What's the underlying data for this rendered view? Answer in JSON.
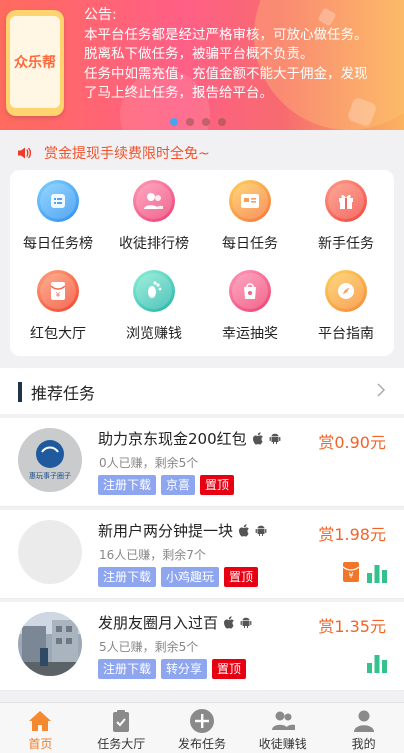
{
  "banner": {
    "logo_text": "众乐帮",
    "notice_title": "公告:",
    "notice_lines": [
      "本平台任务都是经过严格审核，可放心做任务。",
      "脱离私下做任务，被骗平台概不负责。",
      "任务中如需充值，充值金额不能大于佣金，发现",
      "了马上终止任务，报告给平台。"
    ],
    "slide_count": 4,
    "active_slide": 0
  },
  "marquee": {
    "text": "赏金提现手续费限时全免~"
  },
  "menu": {
    "items": [
      {
        "label": "每日任务榜",
        "icon": "list-icon",
        "color": "#3aa8f5"
      },
      {
        "label": "收徒排行榜",
        "icon": "users-icon",
        "color": "#f55a8c"
      },
      {
        "label": "每日任务",
        "icon": "card-icon",
        "color": "#fb9a3c"
      },
      {
        "label": "新手任务",
        "icon": "gift-icon",
        "color": "#f7584e"
      },
      {
        "label": "红包大厅",
        "icon": "red-packet-icon",
        "color": "#f5643c"
      },
      {
        "label": "浏览赚钱",
        "icon": "footprint-icon",
        "color": "#3fc3b5"
      },
      {
        "label": "幸运抽奖",
        "icon": "bag-icon",
        "color": "#f7608a"
      },
      {
        "label": "平台指南",
        "icon": "compass-icon",
        "color": "#fb9f3c"
      }
    ]
  },
  "recommend": {
    "title": "推荐任务",
    "tasks": [
      {
        "title": "助力京东现金200红包",
        "meta": "0人已赚，剩余5个",
        "price": "赏0.90元",
        "tags": [
          {
            "text": "注册下载",
            "color": "blue"
          },
          {
            "text": "京喜",
            "color": "blue"
          },
          {
            "text": "置顶",
            "color": "red"
          }
        ],
        "avatar_text": "惠玩事子圈子"
      },
      {
        "title": "新用户两分钟提一块",
        "meta": "16人已赚，剩余7个",
        "price": "赏1.98元",
        "tags": [
          {
            "text": "注册下载",
            "color": "blue"
          },
          {
            "text": "小鸡趣玩",
            "color": "blue"
          },
          {
            "text": "置顶",
            "color": "red"
          }
        ]
      },
      {
        "title": "发朋友圈月入过百",
        "meta": "5人已赚，剩余5个",
        "price": "赏1.35元",
        "tags": [
          {
            "text": "注册下载",
            "color": "blue"
          },
          {
            "text": "转分享",
            "color": "blue"
          },
          {
            "text": "置顶",
            "color": "red"
          }
        ]
      }
    ]
  },
  "tabbar": {
    "tabs": [
      {
        "label": "首页",
        "icon": "home-icon",
        "active": true
      },
      {
        "label": "任务大厅",
        "icon": "clipboard-icon",
        "active": false
      },
      {
        "label": "发布任务",
        "icon": "plus-circle-icon",
        "active": false
      },
      {
        "label": "收徒赚钱",
        "icon": "users-icon",
        "active": false
      },
      {
        "label": "我的",
        "icon": "person-icon",
        "active": false
      }
    ]
  },
  "colors": {
    "accent": "#f07a28",
    "price": "#f06428",
    "tag_blue": "#8ea6f0",
    "tag_red": "#e60012",
    "marquee": "#f0532e"
  }
}
